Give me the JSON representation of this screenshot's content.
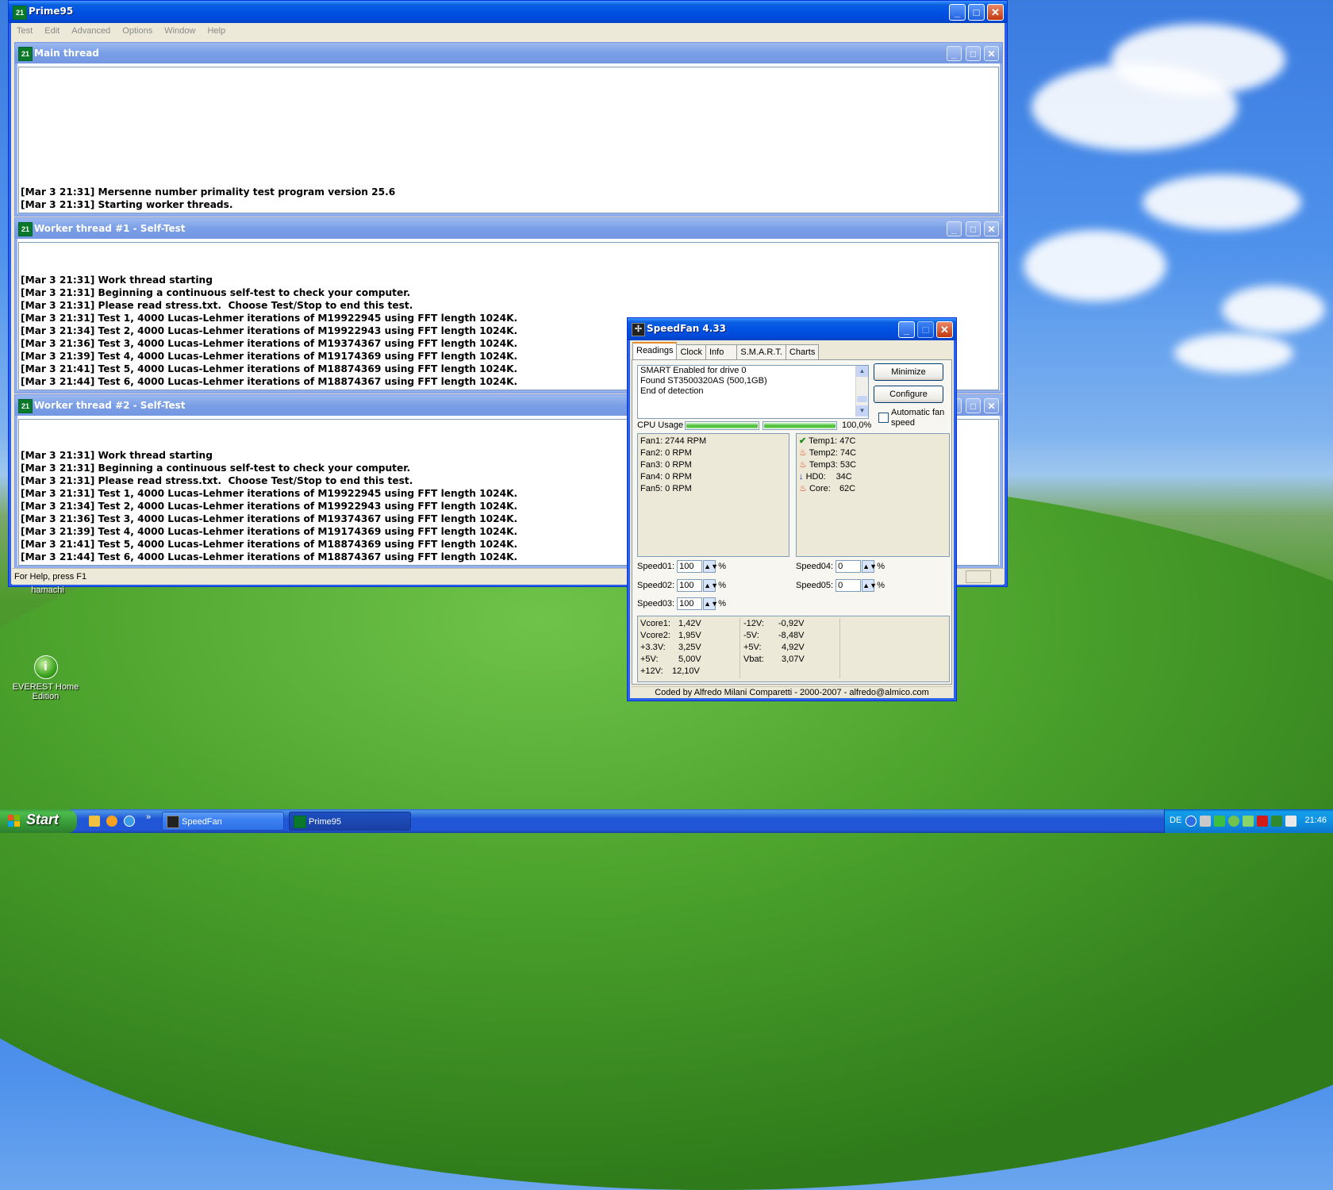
{
  "prime95": {
    "title": "Prime95",
    "menu": [
      "Test",
      "Edit",
      "Advanced",
      "Options",
      "Window",
      "Help"
    ],
    "statusbar": "For Help, press F1",
    "icon_text": "21",
    "main_thread": {
      "title": "Main thread",
      "lines": [
        "[Mar 3 21:31] Mersenne number primality test program version 25.6",
        "[Mar 3 21:31] Starting worker threads."
      ]
    },
    "worker1": {
      "title": "Worker thread #1 - Self-Test",
      "lines": [
        "[Mar 3 21:31] Work thread starting",
        "[Mar 3 21:31] Beginning a continuous self-test to check your computer.",
        "[Mar 3 21:31] Please read stress.txt.  Choose Test/Stop to end this test.",
        "[Mar 3 21:31] Test 1, 4000 Lucas-Lehmer iterations of M19922945 using FFT length 1024K.",
        "[Mar 3 21:34] Test 2, 4000 Lucas-Lehmer iterations of M19922943 using FFT length 1024K.",
        "[Mar 3 21:36] Test 3, 4000 Lucas-Lehmer iterations of M19374367 using FFT length 1024K.",
        "[Mar 3 21:39] Test 4, 4000 Lucas-Lehmer iterations of M19174369 using FFT length 1024K.",
        "[Mar 3 21:41] Test 5, 4000 Lucas-Lehmer iterations of M18874369 using FFT length 1024K.",
        "[Mar 3 21:44] Test 6, 4000 Lucas-Lehmer iterations of M18874367 using FFT length 1024K."
      ]
    },
    "worker2": {
      "title": "Worker thread #2 - Self-Test",
      "lines": [
        "[Mar 3 21:31] Work thread starting",
        "[Mar 3 21:31] Beginning a continuous self-test to check your computer.",
        "[Mar 3 21:31] Please read stress.txt.  Choose Test/Stop to end this test.",
        "[Mar 3 21:31] Test 1, 4000 Lucas-Lehmer iterations of M19922945 using FFT length 1024K.",
        "[Mar 3 21:34] Test 2, 4000 Lucas-Lehmer iterations of M19922943 using FFT length 1024K.",
        "[Mar 3 21:36] Test 3, 4000 Lucas-Lehmer iterations of M19374367 using FFT length 1024K.",
        "[Mar 3 21:39] Test 4, 4000 Lucas-Lehmer iterations of M19174369 using FFT length 1024K.",
        "[Mar 3 21:41] Test 5, 4000 Lucas-Lehmer iterations of M18874369 using FFT length 1024K.",
        "[Mar 3 21:44] Test 6, 4000 Lucas-Lehmer iterations of M18874367 using FFT length 1024K."
      ]
    }
  },
  "speedfan": {
    "title": "SpeedFan 4.33",
    "tabs": [
      "Readings",
      "Clock",
      "Info",
      "S.M.A.R.T.",
      "Charts"
    ],
    "log": [
      "SMART Enabled for drive 0",
      "Found ST3500320AS (500,1GB)",
      "End of detection"
    ],
    "minimize_label": "Minimize",
    "configure_label": "Configure",
    "cpu_usage_label": "CPU Usage",
    "cpu_usage_value": "100,0%",
    "cpu_bars": [
      1.0,
      1.0
    ],
    "auto_fan_label": "Automatic fan speed",
    "fans": [
      "Fan1: 2744 RPM",
      "Fan2: 0 RPM",
      "Fan3: 0 RPM",
      "Fan4: 0 RPM",
      "Fan5: 0 RPM"
    ],
    "temps": [
      {
        "label": "Temp1:",
        "value": "47C",
        "icon": "check-icon"
      },
      {
        "label": "Temp2:",
        "value": "74C",
        "icon": "flame-icon"
      },
      {
        "label": "Temp3:",
        "value": "53C",
        "icon": "flame-icon"
      },
      {
        "label": "HD0:",
        "value": "34C",
        "icon": "arrow-down-icon"
      },
      {
        "label": "Core:",
        "value": "62C",
        "icon": "flame-icon"
      }
    ],
    "speeds": [
      {
        "label": "Speed01:",
        "value": "100"
      },
      {
        "label": "Speed02:",
        "value": "100"
      },
      {
        "label": "Speed03:",
        "value": "100"
      },
      {
        "label": "Speed04:",
        "value": "0"
      },
      {
        "label": "Speed05:",
        "value": "0"
      }
    ],
    "percent_sign": "%",
    "voltages_left": [
      {
        "label": "Vcore1:",
        "value": "1,42V"
      },
      {
        "label": "Vcore2:",
        "value": "1,95V"
      },
      {
        "label": "+3.3V:",
        "value": "3,25V"
      },
      {
        "label": "+5V:",
        "value": "5,00V"
      },
      {
        "label": "+12V:",
        "value": "12,10V"
      }
    ],
    "voltages_right": [
      {
        "label": "-12V:",
        "value": "-0,92V"
      },
      {
        "label": "-5V:",
        "value": "-8,48V"
      },
      {
        "label": "+5V:",
        "value": "4,92V"
      },
      {
        "label": "Vbat:",
        "value": "3,07V"
      }
    ],
    "footer": "Coded by Alfredo Milani Comparetti - 2000-2007 - alfredo@almico.com"
  },
  "desktop": {
    "icons": [
      "hamachi",
      "EVEREST Home Edition"
    ]
  },
  "taskbar": {
    "start_label": "Start",
    "tasks": [
      "SpeedFan",
      "Prime95"
    ],
    "language": "DE",
    "clock": "21:46"
  },
  "colors": {
    "xp_blue": "#0053e4",
    "start_green": "#379a37",
    "close_red": "#c2380e"
  }
}
